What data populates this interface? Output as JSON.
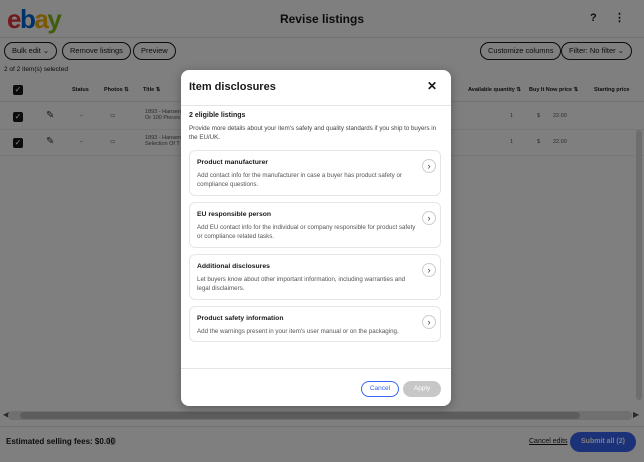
{
  "header": {
    "logo_letters": [
      "e",
      "b",
      "a",
      "y"
    ],
    "logo_colors": [
      "#e53238",
      "#0064d2",
      "#f5af02",
      "#86b817"
    ],
    "title": "Revise listings",
    "help_label": "?",
    "more_label": "⋮"
  },
  "toolbar": {
    "bulk_edit": "Bulk edit  ⌄",
    "remove_listings": "Remove listings",
    "preview": "Preview",
    "customize_columns": "Customize columns",
    "filter": "Filter: No filter  ⌄"
  },
  "selection_text": "2 of 2 item(s) selected",
  "table": {
    "headers": [
      "Status",
      "Photos ⇅",
      "Title ⇅",
      "Available quantity ⇅",
      "Buy It Now price ⇅",
      "Starting price"
    ],
    "rows": [
      {
        "status": "–",
        "photos": "▭",
        "title": "1893 - Hansen ...\nOr 100 Pieces",
        "quantity": "1",
        "currency": "$",
        "price": "22.00"
      },
      {
        "status": "–",
        "photos": "▭",
        "title": "1893 - Hansen ...\nSelection Of T",
        "quantity": "1",
        "currency": "$",
        "price": "22.00"
      }
    ]
  },
  "footer": {
    "fees": "Estimated selling fees: $0.00",
    "cancel": "Cancel edits",
    "submit": "Submit all (2)"
  },
  "modal": {
    "title": "Item disclosures",
    "eligible": "2 eligible listings",
    "intro": "Provide more details about your item's safety and quality standards if you ship to buyers in the EU/UK.",
    "cards": [
      {
        "title": "Product manufacturer",
        "desc": "Add contact info for the manufacturer in case a buyer has product safety or compliance questions."
      },
      {
        "title": "EU responsible person",
        "desc": "Add EU contact info for the individual or company responsible for product safety or compliance related tasks."
      },
      {
        "title": "Additional disclosures",
        "desc": "Let buyers know about other important information, including warranties and legal disclaimers."
      },
      {
        "title": "Product safety information",
        "desc": "Add the warnings present in your item's user manual or on the packaging."
      }
    ],
    "cancel": "Cancel",
    "apply": "Apply"
  }
}
